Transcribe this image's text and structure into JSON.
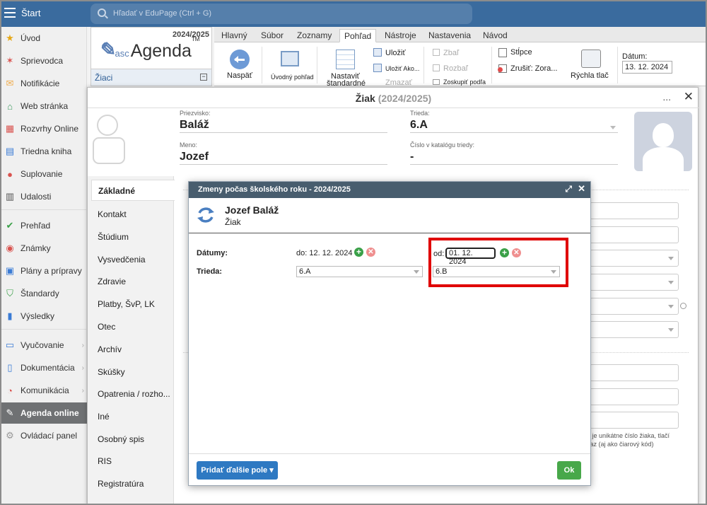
{
  "topbar": {
    "start_label": "Štart",
    "search_placeholder": "Hľadať v EduPage (Ctrl + G)"
  },
  "sidebar": {
    "items": [
      {
        "label": "Úvod",
        "icon": "star-icon",
        "color": "#e6a817"
      },
      {
        "label": "Sprievodca",
        "icon": "wand-icon",
        "color": "#d9534f"
      },
      {
        "label": "Notifikácie",
        "icon": "envelope-icon",
        "color": "#f0ad4e"
      },
      {
        "label": "Web stránka",
        "icon": "home-icon",
        "color": "#3c9a5f"
      },
      {
        "label": "Rozvrhy Online",
        "icon": "calendar-grid-icon",
        "color": "#d9534f"
      },
      {
        "label": "Triedna kniha",
        "icon": "book-icon",
        "color": "#3a7bd5"
      },
      {
        "label": "Suplovanie",
        "icon": "person-icon",
        "color": "#d9534f"
      },
      {
        "label": "Udalosti",
        "icon": "calendar-icon",
        "color": "#555"
      },
      {
        "label": "Prehľad",
        "icon": "check-circle-icon",
        "color": "#3aa048"
      },
      {
        "label": "Známky",
        "icon": "grade-icon",
        "color": "#d9534f"
      },
      {
        "label": "Plány a prípravy",
        "icon": "briefcase-icon",
        "color": "#3a7bd5"
      },
      {
        "label": "Štandardy",
        "icon": "shield-icon",
        "color": "#3aa048"
      },
      {
        "label": "Výsledky",
        "icon": "bar-chart-icon",
        "color": "#3a7bd5"
      },
      {
        "label": "Vyučovanie",
        "icon": "open-book-icon",
        "color": "#3a7bd5"
      },
      {
        "label": "Dokumentácia",
        "icon": "document-icon",
        "color": "#3a7bd5"
      },
      {
        "label": "Komunikácia",
        "icon": "chat-icon",
        "color": "#d9534f"
      },
      {
        "label": "Agenda online",
        "icon": "pen-icon",
        "color": "#ffffff"
      },
      {
        "label": "Ovládací panel",
        "icon": "gear-icon",
        "color": "#999"
      }
    ]
  },
  "app": {
    "year": "2024/2025",
    "logo_asc": "asc",
    "logo_agenda": "Agenda",
    "logo_tm": "TM",
    "panel_title": "Žiaci"
  },
  "tabs": [
    "Hlavný",
    "Súbor",
    "Zoznamy",
    "Pohľad",
    "Nástroje",
    "Nastavenia",
    "Návod"
  ],
  "ribbon": {
    "back": "Naspäť",
    "home_view": "Úvodný pohľad",
    "set_standard_1": "Nastaviť",
    "set_standard_2": "štandardné",
    "save": "Uložiť",
    "save_as": "Uložiť Ako...",
    "delete": "Zmazať",
    "collapse": "Zbaľ",
    "expand": "Rozbaľ",
    "group_by": "Zoskupiť podľa",
    "columns": "Stĺpce",
    "cancel_sort": "Zrušiť: Zora...",
    "quick_print": "Rýchla tlač",
    "date_label": "Dátum:",
    "date_value": "13. 12. 2024"
  },
  "student": {
    "title": "Žiak",
    "title_year": "(2024/2025)",
    "more": "...",
    "close": "✕",
    "surname_label": "Priezvisko:",
    "surname": "Baláž",
    "name_label": "Meno:",
    "name": "Jozef",
    "class_label": "Trieda:",
    "class": "6.A",
    "catalog_label": "Číslo v katalógu triedy:",
    "catalog": "-"
  },
  "left_menu": [
    "Základné",
    "Kontakt",
    "Štúdium",
    "Vysvedčenia",
    "Zdravie",
    "Platby, ŠvP, LK",
    "Otec",
    "Archív",
    "Skúšky",
    "Opatrenia / rozho...",
    "Iné",
    "Osobný spis",
    "RIS",
    "Registratúra"
  ],
  "hint": {
    "line1": "o je unikátne číslo žiaka, tlačí",
    "line2": "kaz (aj ako čiarový kód)"
  },
  "dialog": {
    "title": "Zmeny počas školského roku - 2024/2025",
    "expand": "⤢",
    "close": "✕",
    "person_name": "Jozef Baláž",
    "person_role": "Žiak",
    "dates_label": "Dátumy:",
    "class_label": "Trieda:",
    "to_label": "do:",
    "to_date": "12. 12. 2024",
    "from_label": "od:",
    "from_date": "01. 12. 2024",
    "class_old": "6.A",
    "class_new": "6.B",
    "add_field": "Pridať ďalšie pole ▾",
    "ok": "Ok"
  }
}
